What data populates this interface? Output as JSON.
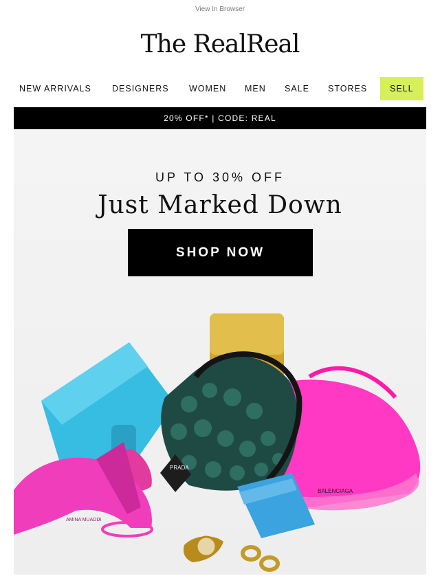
{
  "header": {
    "view_in_browser": "View In Browser",
    "logo": "The RealReal"
  },
  "nav": {
    "items": [
      "NEW ARRIVALS",
      "DESIGNERS",
      "WOMEN",
      "MEN",
      "SALE",
      "STORES",
      "SELL"
    ]
  },
  "promo": {
    "text": "20% OFF*  |  CODE: REAL"
  },
  "hero": {
    "kicker": "UP TO 30% OFF",
    "title": "Just Marked Down",
    "button": "SHOP NOW",
    "image_labels": {
      "shoe_brand": "BALENCIAGA",
      "prada_plate": "PRADA",
      "heel_brand": "AMINA MUADDI"
    }
  },
  "colors": {
    "sell_bg": "#d6f05a",
    "promo_bg": "#000000",
    "hero_bg": "#f0f0f0",
    "pink": "#ff2fb6",
    "teal": "#35bde0",
    "gold": "#d4a62a"
  }
}
